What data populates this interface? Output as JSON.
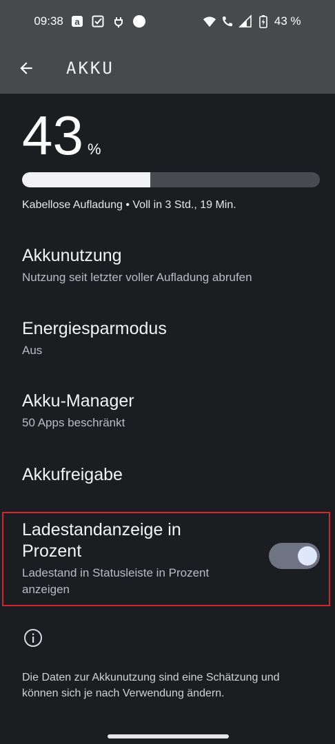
{
  "status_bar": {
    "time": "09:38",
    "battery_text": "43 %",
    "left_icons": [
      "amazon-icon",
      "checkbox-icon",
      "charging-plug-icon",
      "dot-icon"
    ],
    "right_icons": [
      "wifi-icon",
      "wifi-call-icon",
      "signal-icon",
      "battery-charging-icon"
    ]
  },
  "app_bar": {
    "title": "AKKU",
    "back_icon": "arrow-left-icon"
  },
  "battery": {
    "level": "43",
    "unit": "%",
    "level_fraction": 0.43,
    "status": "Kabellose Aufladung • Voll in 3 Std., 19 Min."
  },
  "items": [
    {
      "title": "Akkunutzung",
      "summary": "Nutzung seit letzter voller Aufladung abrufen"
    },
    {
      "title": "Energiesparmodus",
      "summary": "Aus"
    },
    {
      "title": "Akku-Manager",
      "summary": "50 Apps beschränkt"
    },
    {
      "title": "Akkufreigabe",
      "summary": ""
    }
  ],
  "percentage_toggle": {
    "title": "Ladestandanzeige in Prozent",
    "summary": "Ladestand in Statusleiste in Prozent anzeigen",
    "enabled": true
  },
  "footer": {
    "info_icon": "info-icon",
    "text": "Die Daten zur Akkunutzung sind eine Schätzung und können sich je nach Verwendung ändern."
  },
  "colors": {
    "background": "#1c1d21",
    "app_bar": "#48494d",
    "highlight_border": "#d1262c",
    "switch_track": "#6f7485",
    "switch_thumb": "#dfe7fb"
  }
}
